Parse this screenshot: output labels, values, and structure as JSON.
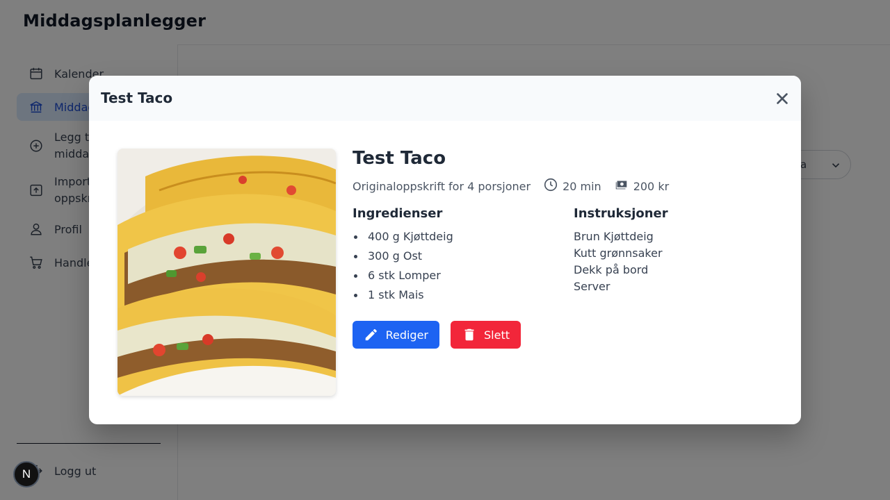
{
  "app": {
    "title": "Middagsplanlegger",
    "nav": [
      {
        "label": "Kalender",
        "icon": "calendar-icon"
      },
      {
        "label": "Middager",
        "icon": "bank-icon",
        "active": true
      },
      {
        "label": "Legg til middag",
        "icon": "plus-circle-icon"
      },
      {
        "label": "Importer oppskrift",
        "icon": "upload-icon"
      },
      {
        "label": "Profil",
        "icon": "user-icon"
      },
      {
        "label": "Handleliste",
        "icon": "cart-icon"
      }
    ],
    "logout_label": "Logg ut",
    "select_value": "a",
    "badge": "N"
  },
  "modal": {
    "title": "Test Taco",
    "recipe": {
      "name": "Test Taco",
      "servings_text": "Originaloppskrift for 4 porsjoner",
      "time": "20 min",
      "cost": "200 kr",
      "ingredients_heading": "Ingredienser",
      "ingredients": [
        "400 g Kjøttdeig",
        "300 g Ost",
        "6 stk Lomper",
        "1 stk Mais"
      ],
      "instructions_heading": "Instruksjoner",
      "instructions": [
        "Brun Kjøttdeig",
        "Kutt grønnsaker",
        "Dekk på bord",
        "Server"
      ]
    },
    "buttons": {
      "edit": "Rediger",
      "delete": "Slett"
    }
  },
  "colors": {
    "primary": "#1d63f2",
    "danger": "#f2263a",
    "active_nav_bg": "#dbeafe"
  }
}
